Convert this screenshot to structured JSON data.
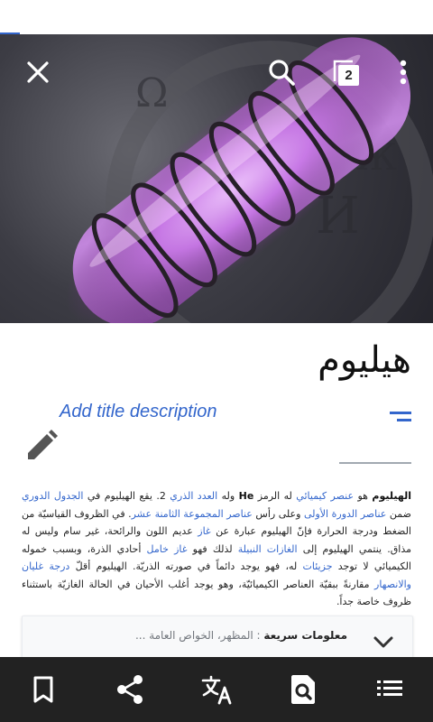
{
  "app": {
    "accent_color": "#3366cc",
    "bottom_bar_color": "#222222",
    "topbar_icons": [
      "close-icon",
      "search-icon",
      "tabs-icon",
      "more-vertical-icon"
    ],
    "tabs_count": "2"
  },
  "article": {
    "title": "هيليوم",
    "add_description": "Add title description",
    "body": [
      {
        "text": "الهيليوم",
        "type": "bold"
      },
      {
        "text": " هو ",
        "type": "text"
      },
      {
        "text": "عنصر كيميائي",
        "type": "link"
      },
      {
        "text": " له الرمز ",
        "type": "text"
      },
      {
        "text": "He",
        "type": "bold"
      },
      {
        "text": " وله ",
        "type": "text"
      },
      {
        "text": "العدد الذري",
        "type": "link"
      },
      {
        "text": " 2. يقع الهيليوم في ",
        "type": "text"
      },
      {
        "text": "الجدول الدوري",
        "type": "link"
      },
      {
        "text": " ضمن ",
        "type": "text"
      },
      {
        "text": "عناصر الدورة الأولى",
        "type": "link"
      },
      {
        "text": " وعلى رأس ",
        "type": "text"
      },
      {
        "text": "عناصر المجموعة الثامنة عشر",
        "type": "link"
      },
      {
        "text": ". في الظروف القياسيّة من الضغط ودرجة الحرارة فإنّ الهيليوم عبارة عن ",
        "type": "text"
      },
      {
        "text": "غاز",
        "type": "link"
      },
      {
        "text": " عديم اللون والرائحة، غير سام وليس له مذاق. ينتمي الهيليوم إلى ",
        "type": "text"
      },
      {
        "text": "الغازات النبيلة",
        "type": "link"
      },
      {
        "text": " لذلك فهو ",
        "type": "text"
      },
      {
        "text": "غاز خامل",
        "type": "link"
      },
      {
        "text": " أحادي الذرة، وبسبب خموله الكيميائي لا توجد ",
        "type": "text"
      },
      {
        "text": "جزيئات",
        "type": "link"
      },
      {
        "text": " له، فهو يوجد دائماً في صورته الذريّة. الهيليوم أقلّ ",
        "type": "text"
      },
      {
        "text": "درجة غليان والانصهار",
        "type": "link"
      },
      {
        "text": " مقارنةً ببقيّة العناصر الكيميائيّة، وهو يوجد أغلب الأحيان في الحالة الغازيّة باستثناء ظروف خاصة جداً.",
        "type": "text"
      }
    ]
  },
  "quick_facts": {
    "label": "معلومات سريعة",
    "subtitle": " : المظهر، الخواص العامة ..."
  },
  "bottom_bar": {
    "icons": [
      "bookmark-icon",
      "share-icon",
      "translate-icon",
      "find-in-page-icon",
      "contents-icon"
    ]
  }
}
